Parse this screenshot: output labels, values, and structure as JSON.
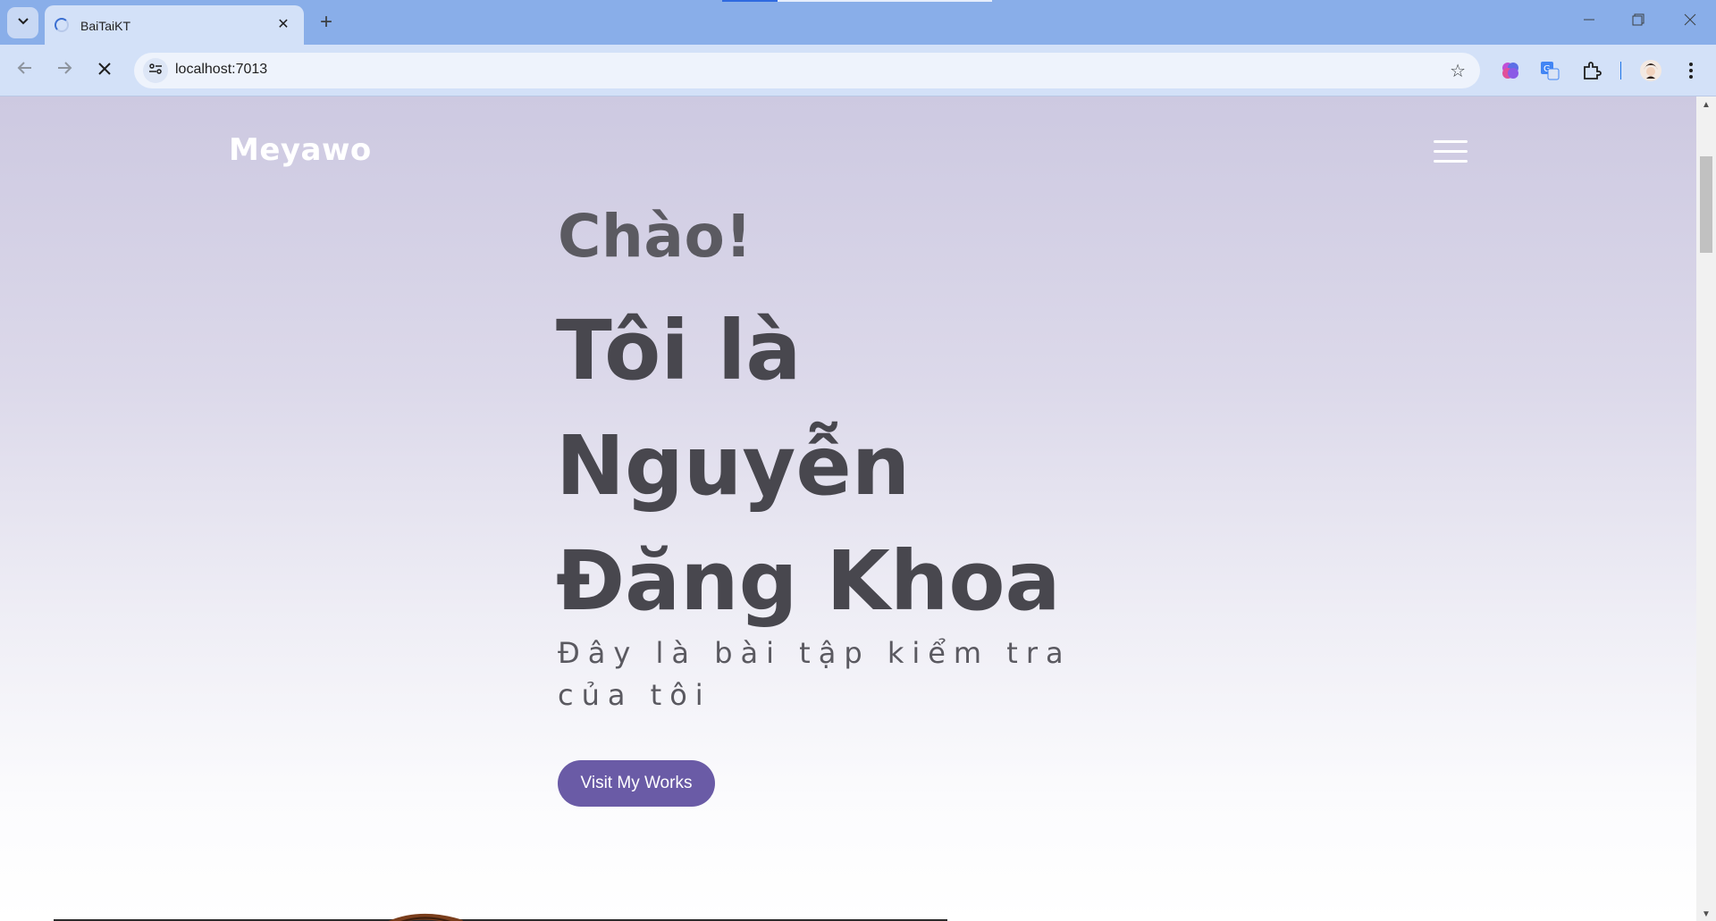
{
  "browser": {
    "tab_title": "BaiTaiKT",
    "url": "localhost:7013",
    "icons": {
      "tab_search": "chevron-down-icon",
      "tab_close": "close-icon",
      "new_tab": "plus-icon",
      "back": "arrow-left-icon",
      "forward": "arrow-right-icon",
      "stop": "close-icon",
      "site_info": "tune-icon",
      "bookmark": "star-icon",
      "ext1": "brain-icon",
      "ext2": "translate-icon",
      "extensions": "puzzle-icon",
      "profile": "avatar",
      "menu": "kebab-icon",
      "minimize": "minimize-icon",
      "restore": "restore-icon",
      "close_window": "close-icon"
    }
  },
  "page": {
    "logo": "Meyawo",
    "greeting": "Chào!",
    "name_line1": "Tôi là",
    "name_line2": "Nguyễn",
    "name_line3": "Đăng Khoa",
    "subtitle_line1": "Đây là bài tập kiểm tra",
    "subtitle_line2": "của tôi",
    "cta_label": "Visit My Works"
  },
  "colors": {
    "accent": "#6a5ba6",
    "heading": "#48474e",
    "tabstrip": "#89aee9"
  }
}
